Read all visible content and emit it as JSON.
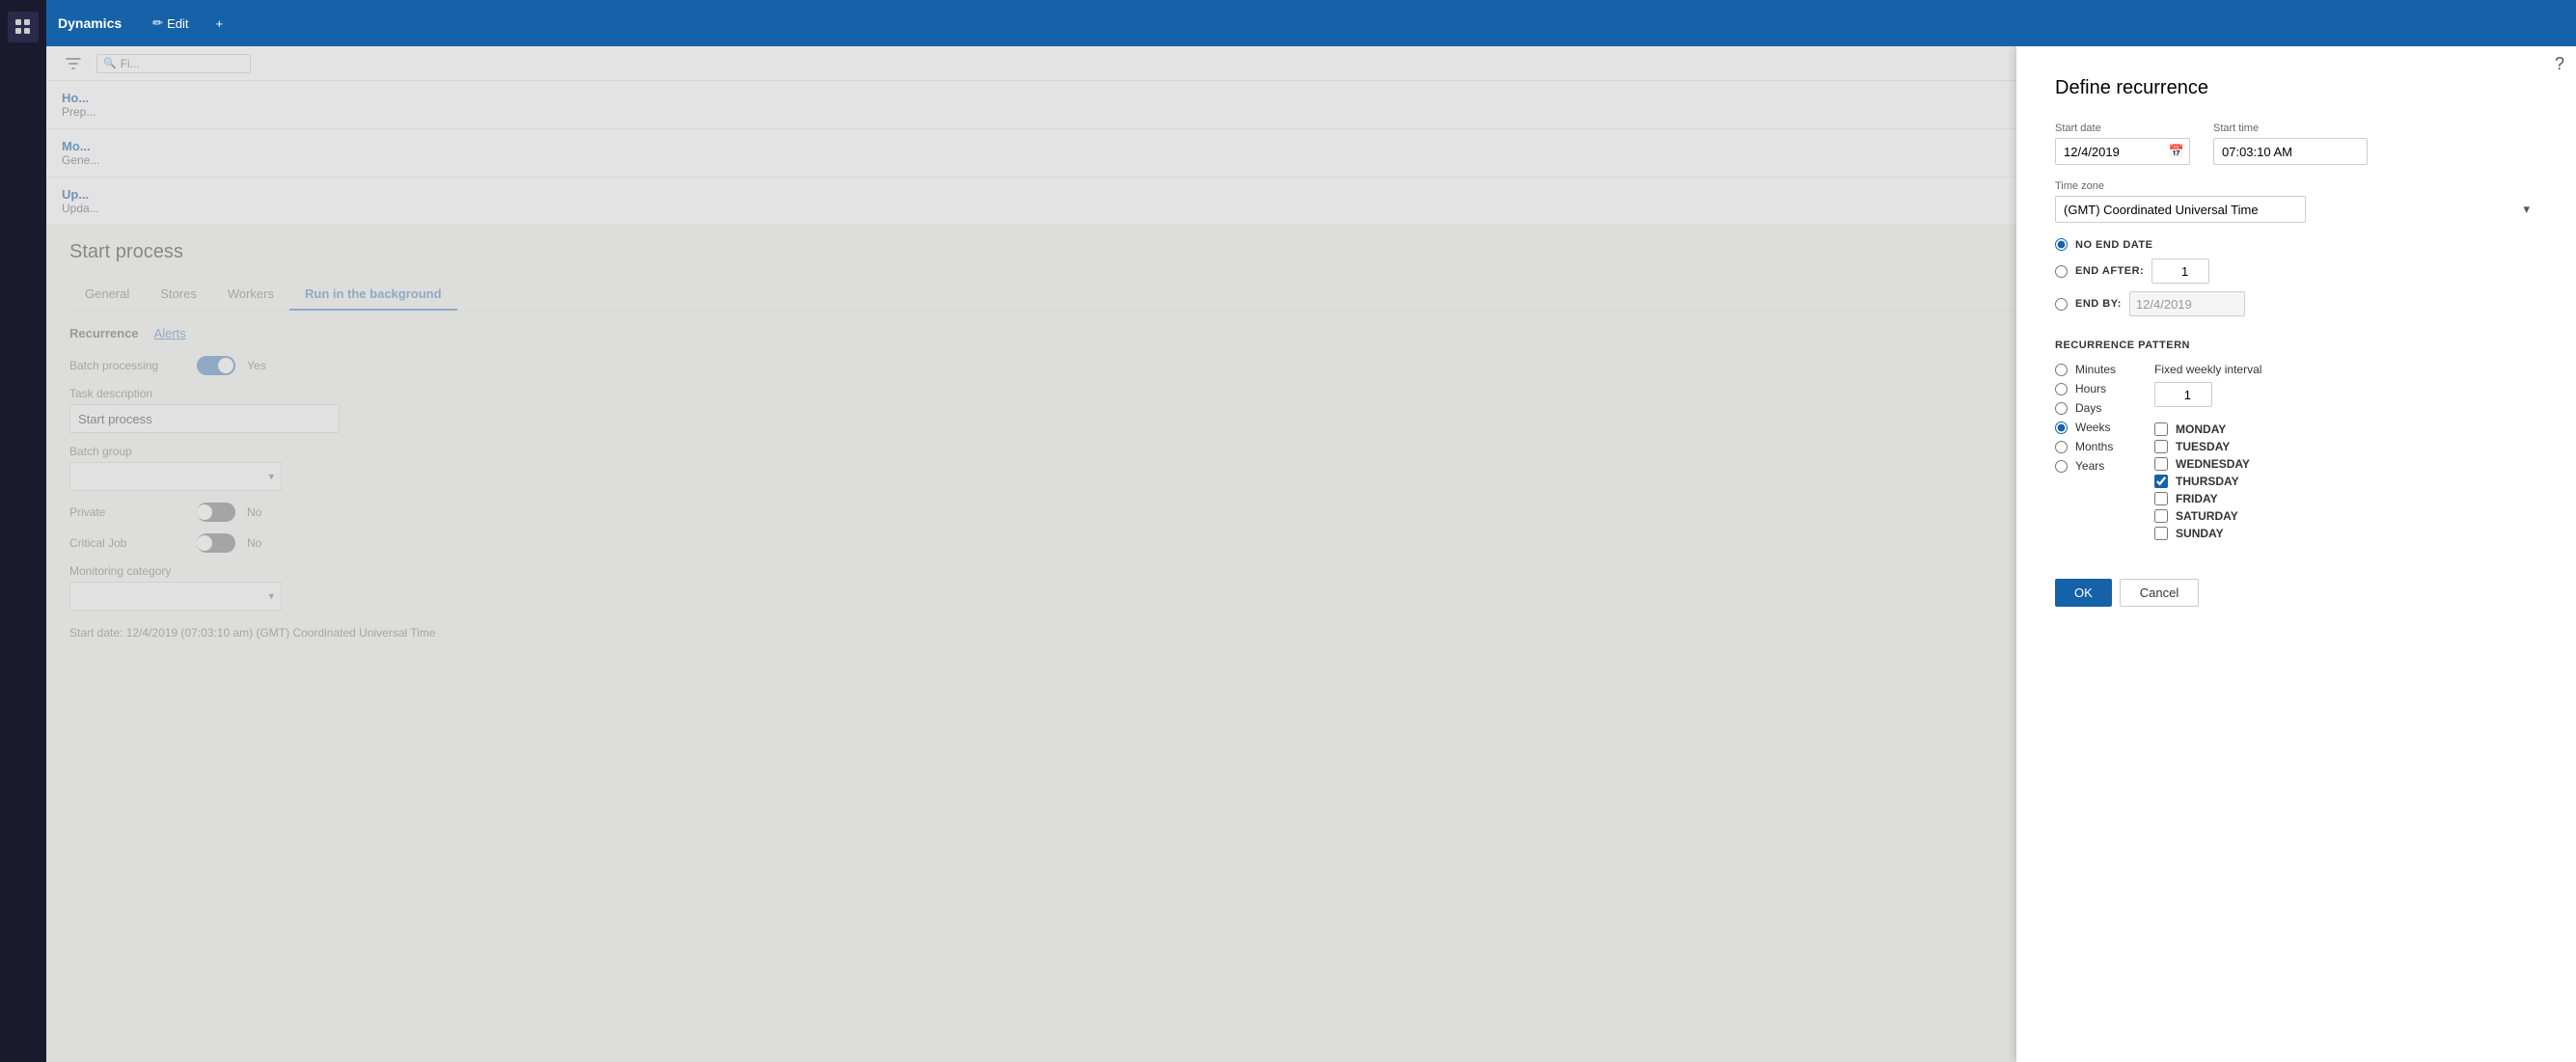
{
  "app": {
    "title": "Dynamics",
    "edit_label": "Edit",
    "add_label": "+"
  },
  "secondary_bar": {
    "search_placeholder": "Fi..."
  },
  "list_items": [
    {
      "title": "Ho...",
      "sub": "Prep..."
    },
    {
      "title": "Mo...",
      "sub": "Gene..."
    },
    {
      "title": "Up...",
      "sub": "Upda..."
    }
  ],
  "start_process": {
    "title": "Start process",
    "tabs": [
      "General",
      "Stores",
      "Workers",
      "Run in the background"
    ],
    "active_tab": "Run in the background",
    "sub_tabs": [
      "Recurrence",
      "Alerts"
    ],
    "active_sub_tab": "Recurrence",
    "batch_processing": {
      "label": "Batch processing",
      "toggle_label": "Yes",
      "toggle_state": "on"
    },
    "task_description": {
      "label": "Task description",
      "value": "Start process"
    },
    "batch_group": {
      "label": "Batch group",
      "value": ""
    },
    "private": {
      "label": "Private",
      "toggle_label": "No",
      "toggle_state": "on_dark"
    },
    "critical_job": {
      "label": "Critical Job",
      "toggle_label": "No",
      "toggle_state": "on_dark"
    },
    "monitoring_category": {
      "label": "Monitoring category",
      "value": ""
    },
    "start_date_text": "Start date: 12/4/2019 (07:03:10 am) (GMT) Coordinated Universal Time"
  },
  "define_recurrence": {
    "title": "Define recurrence",
    "start_date_label": "Start date",
    "start_date_value": "12/4/2019",
    "start_time_label": "Start time",
    "start_time_value": "07:03:10 AM",
    "timezone_label": "Time zone",
    "timezone_value": "(GMT) Coordinated Universal Time",
    "end_options": [
      {
        "id": "no_end",
        "label": "NO END DATE",
        "checked": true
      },
      {
        "id": "end_after",
        "label": "END AFTER:",
        "checked": false
      },
      {
        "id": "end_by",
        "label": "END BY:",
        "checked": false
      }
    ],
    "end_after_value": "1",
    "end_by_value": "12/4/2019",
    "recurrence_pattern_label": "RECURRENCE PATTERN",
    "pattern_options": [
      {
        "id": "minutes",
        "label": "Minutes",
        "checked": false
      },
      {
        "id": "hours",
        "label": "Hours",
        "checked": false
      },
      {
        "id": "days",
        "label": "Days",
        "checked": false
      },
      {
        "id": "weeks",
        "label": "Weeks",
        "checked": true
      },
      {
        "id": "months",
        "label": "Months",
        "checked": false
      },
      {
        "id": "years",
        "label": "Years",
        "checked": false
      }
    ],
    "fixed_weekly_interval_label": "Fixed weekly interval",
    "fixed_weekly_interval_value": "1",
    "days_of_week": [
      {
        "id": "monday",
        "label": "MONDAY",
        "checked": false
      },
      {
        "id": "tuesday",
        "label": "TUESDAY",
        "checked": false
      },
      {
        "id": "wednesday",
        "label": "WEDNESDAY",
        "checked": false
      },
      {
        "id": "thursday",
        "label": "THURSDAY",
        "checked": true
      },
      {
        "id": "friday",
        "label": "FRIDAY",
        "checked": false
      },
      {
        "id": "saturday",
        "label": "SATURDAY",
        "checked": false
      },
      {
        "id": "sunday",
        "label": "SUNDAY",
        "checked": false
      }
    ],
    "ok_label": "OK",
    "cancel_label": "Cancel"
  },
  "icons": {
    "apps": "⊞",
    "home": "⌂",
    "star": "☆",
    "clock": "🕐",
    "grid": "▦",
    "list": "☰",
    "search": "🔍",
    "calendar": "📅",
    "chevron_down": "▾",
    "pencil": "✏",
    "help": "?"
  }
}
